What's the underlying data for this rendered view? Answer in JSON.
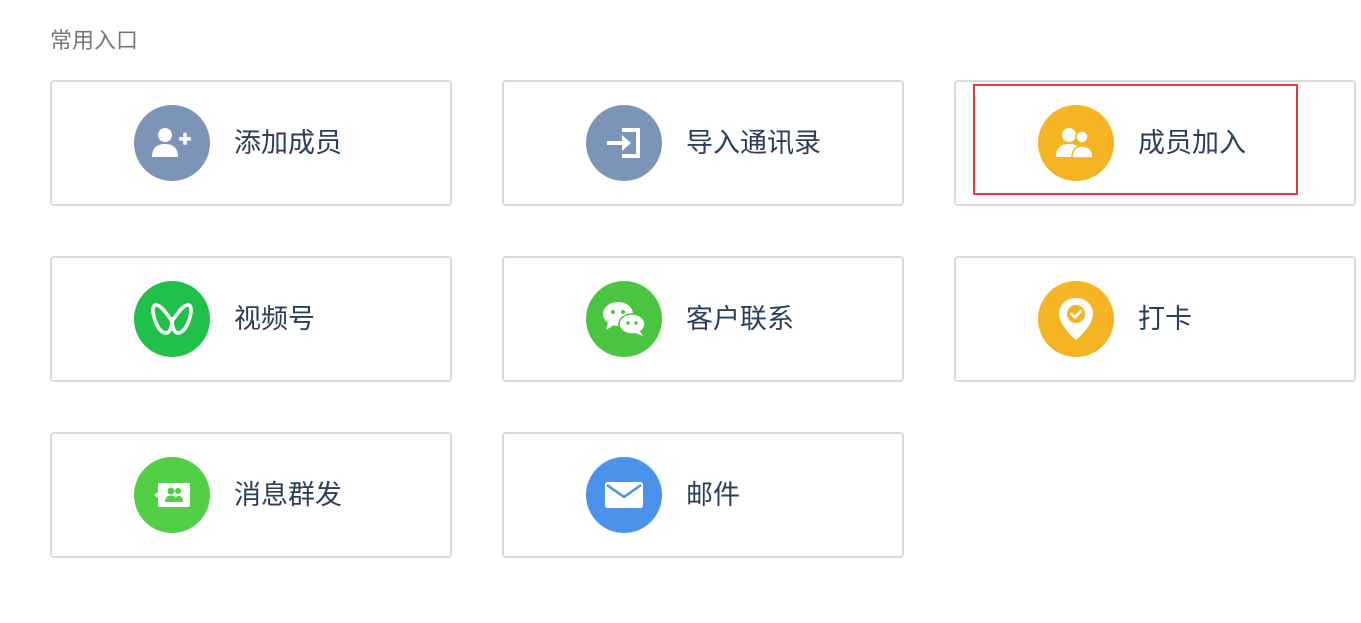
{
  "section": {
    "title": "常用入口"
  },
  "entries": [
    {
      "label": "添加成员",
      "icon": "add-member-icon",
      "color": "#7d94b9"
    },
    {
      "label": "导入通讯录",
      "icon": "import-icon",
      "color": "#7d94b9"
    },
    {
      "label": "成员加入",
      "icon": "members-join-icon",
      "color": "#f5b423",
      "highlighted": true
    },
    {
      "label": "视频号",
      "icon": "channels-icon",
      "color": "#21c04a"
    },
    {
      "label": "客户联系",
      "icon": "wechat-chat-icon",
      "color": "#4bc541"
    },
    {
      "label": "打卡",
      "icon": "location-check-icon",
      "color": "#f5b423"
    },
    {
      "label": "消息群发",
      "icon": "broadcast-message-icon",
      "color": "#52cf45"
    },
    {
      "label": "邮件",
      "icon": "mail-icon",
      "color": "#4b93ea"
    }
  ],
  "highlight_color": "#e03d3d"
}
